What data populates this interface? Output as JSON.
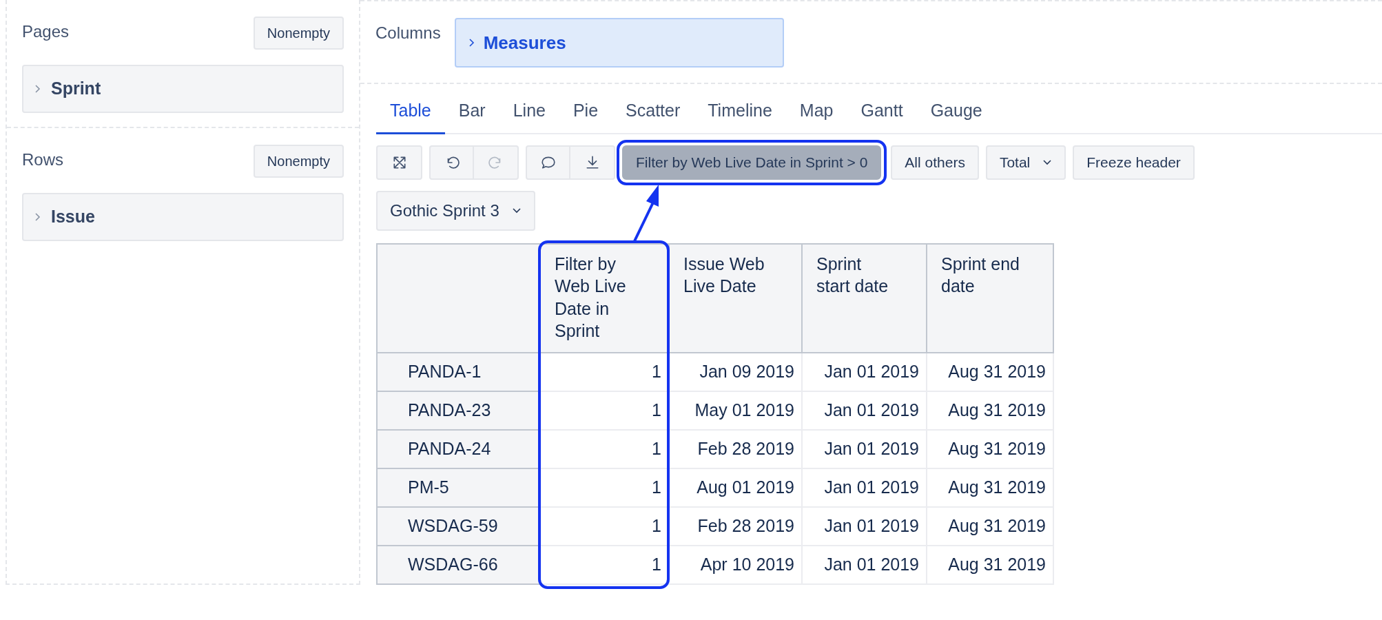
{
  "pages": {
    "title": "Pages",
    "button": "Nonempty",
    "items": [
      {
        "label": "Sprint",
        "expanded": false
      }
    ]
  },
  "rows": {
    "title": "Rows",
    "button": "Nonempty",
    "items": [
      {
        "label": "Issue",
        "expanded": false
      }
    ]
  },
  "columns": {
    "title": "Columns",
    "items": [
      {
        "label": "Measures",
        "expanded": false
      }
    ]
  },
  "tabs": [
    {
      "label": "Table",
      "selected": true
    },
    {
      "label": "Bar",
      "selected": false
    },
    {
      "label": "Line",
      "selected": false
    },
    {
      "label": "Pie",
      "selected": false
    },
    {
      "label": "Scatter",
      "selected": false
    },
    {
      "label": "Timeline",
      "selected": false
    },
    {
      "label": "Map",
      "selected": false
    },
    {
      "label": "Gantt",
      "selected": false
    },
    {
      "label": "Gauge",
      "selected": false
    }
  ],
  "toolbar": {
    "icon_groups": [
      [
        {
          "kind": "fullscreen",
          "disabled": false
        }
      ],
      [
        {
          "kind": "undo",
          "disabled": false
        },
        {
          "kind": "redo",
          "disabled": true
        }
      ],
      [
        {
          "kind": "comment",
          "disabled": false
        },
        {
          "kind": "download",
          "disabled": false
        }
      ]
    ],
    "buttons": [
      {
        "label": "Filter by Web Live Date in Sprint > 0",
        "selected": true,
        "highlighted": true,
        "dropdown": false
      },
      {
        "label": "All others",
        "selected": false,
        "highlighted": false,
        "dropdown": false
      },
      {
        "label": "Total",
        "selected": false,
        "highlighted": false,
        "dropdown": true
      },
      {
        "label": "Freeze header",
        "selected": false,
        "highlighted": false,
        "dropdown": false
      }
    ]
  },
  "page_selector": {
    "value": "Gothic Sprint 3"
  },
  "table": {
    "columns": [
      {
        "label": "Filter by Web Live Date in Sprint",
        "highlighted": true
      },
      {
        "label": "Issue Web Live Date",
        "highlighted": false
      },
      {
        "label": "Sprint start date",
        "highlighted": false
      },
      {
        "label": "Sprint end date",
        "highlighted": false
      }
    ],
    "rows": [
      {
        "label": "PANDA-1",
        "cells": [
          "1",
          "Jan 09 2019",
          "Jan 01 2019",
          "Aug 31 2019"
        ]
      },
      {
        "label": "PANDA-23",
        "cells": [
          "1",
          "May 01 2019",
          "Jan 01 2019",
          "Aug 31 2019"
        ]
      },
      {
        "label": "PANDA-24",
        "cells": [
          "1",
          "Feb 28 2019",
          "Jan 01 2019",
          "Aug 31 2019"
        ]
      },
      {
        "label": "PM-5",
        "cells": [
          "1",
          "Aug 01 2019",
          "Jan 01 2019",
          "Aug 31 2019"
        ]
      },
      {
        "label": "WSDAG-59",
        "cells": [
          "1",
          "Feb 28 2019",
          "Jan 01 2019",
          "Aug 31 2019"
        ]
      },
      {
        "label": "WSDAG-66",
        "cells": [
          "1",
          "Apr 10 2019",
          "Jan 01 2019",
          "Aug 31 2019"
        ]
      }
    ]
  }
}
